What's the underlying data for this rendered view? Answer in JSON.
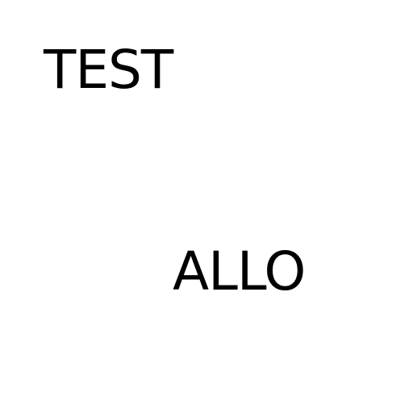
{
  "colors": {
    "background": "#ffffff",
    "text": "#000000"
  },
  "texts": {
    "top": "TEST",
    "bottom": "ALLO"
  }
}
